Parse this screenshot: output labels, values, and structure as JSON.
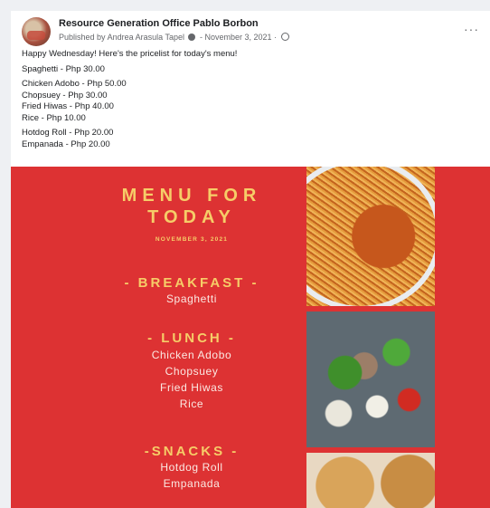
{
  "post": {
    "page_name": "Resource Generation Office Pablo Borbon",
    "published_prefix": "Published by",
    "author": "Andrea Arasula Tapel",
    "date": "November 3, 2021",
    "more_icon": "more-horizontal-icon",
    "lines": [
      "Happy Wednesday! Here's the pricelist for today's menu!",
      "Spaghetti - Php 30.00",
      "Chicken Adobo - Php 50.00",
      "Chopsuey - Php 30.00",
      "Fried Hiwas - Php 40.00",
      "Rice - Php 10.00",
      "Hotdog Roll - Php 20.00",
      "Empanada - Php 20.00"
    ]
  },
  "menu_image": {
    "title_line1": "MENU FOR",
    "title_line2": "TODAY",
    "date": "NOVEMBER 3, 2021",
    "breakfast": {
      "heading": "- BREAKFAST -",
      "items": [
        "Spaghetti"
      ]
    },
    "lunch": {
      "heading": "- LUNCH -",
      "items": [
        "Chicken Adobo",
        "Chopsuey",
        "Fried Hiwas",
        "Rice"
      ]
    },
    "snacks": {
      "heading": "-SNACKS -",
      "items": [
        "Hotdog Roll",
        "Empanada"
      ]
    },
    "colors": {
      "background": "#dd3233",
      "heading": "#f6cd68",
      "item": "#fbe9e3"
    }
  }
}
